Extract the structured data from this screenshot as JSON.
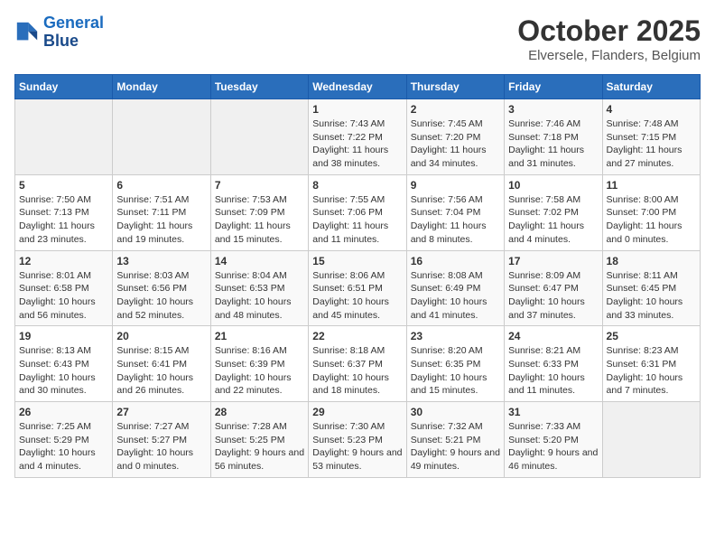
{
  "header": {
    "logo_line1": "General",
    "logo_line2": "Blue",
    "main_title": "October 2025",
    "subtitle": "Elversele, Flanders, Belgium"
  },
  "days_of_week": [
    "Sunday",
    "Monday",
    "Tuesday",
    "Wednesday",
    "Thursday",
    "Friday",
    "Saturday"
  ],
  "weeks": [
    [
      {
        "num": "",
        "sunrise": "",
        "sunset": "",
        "daylight": ""
      },
      {
        "num": "",
        "sunrise": "",
        "sunset": "",
        "daylight": ""
      },
      {
        "num": "",
        "sunrise": "",
        "sunset": "",
        "daylight": ""
      },
      {
        "num": "1",
        "sunrise": "Sunrise: 7:43 AM",
        "sunset": "Sunset: 7:22 PM",
        "daylight": "Daylight: 11 hours and 38 minutes."
      },
      {
        "num": "2",
        "sunrise": "Sunrise: 7:45 AM",
        "sunset": "Sunset: 7:20 PM",
        "daylight": "Daylight: 11 hours and 34 minutes."
      },
      {
        "num": "3",
        "sunrise": "Sunrise: 7:46 AM",
        "sunset": "Sunset: 7:18 PM",
        "daylight": "Daylight: 11 hours and 31 minutes."
      },
      {
        "num": "4",
        "sunrise": "Sunrise: 7:48 AM",
        "sunset": "Sunset: 7:15 PM",
        "daylight": "Daylight: 11 hours and 27 minutes."
      }
    ],
    [
      {
        "num": "5",
        "sunrise": "Sunrise: 7:50 AM",
        "sunset": "Sunset: 7:13 PM",
        "daylight": "Daylight: 11 hours and 23 minutes."
      },
      {
        "num": "6",
        "sunrise": "Sunrise: 7:51 AM",
        "sunset": "Sunset: 7:11 PM",
        "daylight": "Daylight: 11 hours and 19 minutes."
      },
      {
        "num": "7",
        "sunrise": "Sunrise: 7:53 AM",
        "sunset": "Sunset: 7:09 PM",
        "daylight": "Daylight: 11 hours and 15 minutes."
      },
      {
        "num": "8",
        "sunrise": "Sunrise: 7:55 AM",
        "sunset": "Sunset: 7:06 PM",
        "daylight": "Daylight: 11 hours and 11 minutes."
      },
      {
        "num": "9",
        "sunrise": "Sunrise: 7:56 AM",
        "sunset": "Sunset: 7:04 PM",
        "daylight": "Daylight: 11 hours and 8 minutes."
      },
      {
        "num": "10",
        "sunrise": "Sunrise: 7:58 AM",
        "sunset": "Sunset: 7:02 PM",
        "daylight": "Daylight: 11 hours and 4 minutes."
      },
      {
        "num": "11",
        "sunrise": "Sunrise: 8:00 AM",
        "sunset": "Sunset: 7:00 PM",
        "daylight": "Daylight: 11 hours and 0 minutes."
      }
    ],
    [
      {
        "num": "12",
        "sunrise": "Sunrise: 8:01 AM",
        "sunset": "Sunset: 6:58 PM",
        "daylight": "Daylight: 10 hours and 56 minutes."
      },
      {
        "num": "13",
        "sunrise": "Sunrise: 8:03 AM",
        "sunset": "Sunset: 6:56 PM",
        "daylight": "Daylight: 10 hours and 52 minutes."
      },
      {
        "num": "14",
        "sunrise": "Sunrise: 8:04 AM",
        "sunset": "Sunset: 6:53 PM",
        "daylight": "Daylight: 10 hours and 48 minutes."
      },
      {
        "num": "15",
        "sunrise": "Sunrise: 8:06 AM",
        "sunset": "Sunset: 6:51 PM",
        "daylight": "Daylight: 10 hours and 45 minutes."
      },
      {
        "num": "16",
        "sunrise": "Sunrise: 8:08 AM",
        "sunset": "Sunset: 6:49 PM",
        "daylight": "Daylight: 10 hours and 41 minutes."
      },
      {
        "num": "17",
        "sunrise": "Sunrise: 8:09 AM",
        "sunset": "Sunset: 6:47 PM",
        "daylight": "Daylight: 10 hours and 37 minutes."
      },
      {
        "num": "18",
        "sunrise": "Sunrise: 8:11 AM",
        "sunset": "Sunset: 6:45 PM",
        "daylight": "Daylight: 10 hours and 33 minutes."
      }
    ],
    [
      {
        "num": "19",
        "sunrise": "Sunrise: 8:13 AM",
        "sunset": "Sunset: 6:43 PM",
        "daylight": "Daylight: 10 hours and 30 minutes."
      },
      {
        "num": "20",
        "sunrise": "Sunrise: 8:15 AM",
        "sunset": "Sunset: 6:41 PM",
        "daylight": "Daylight: 10 hours and 26 minutes."
      },
      {
        "num": "21",
        "sunrise": "Sunrise: 8:16 AM",
        "sunset": "Sunset: 6:39 PM",
        "daylight": "Daylight: 10 hours and 22 minutes."
      },
      {
        "num": "22",
        "sunrise": "Sunrise: 8:18 AM",
        "sunset": "Sunset: 6:37 PM",
        "daylight": "Daylight: 10 hours and 18 minutes."
      },
      {
        "num": "23",
        "sunrise": "Sunrise: 8:20 AM",
        "sunset": "Sunset: 6:35 PM",
        "daylight": "Daylight: 10 hours and 15 minutes."
      },
      {
        "num": "24",
        "sunrise": "Sunrise: 8:21 AM",
        "sunset": "Sunset: 6:33 PM",
        "daylight": "Daylight: 10 hours and 11 minutes."
      },
      {
        "num": "25",
        "sunrise": "Sunrise: 8:23 AM",
        "sunset": "Sunset: 6:31 PM",
        "daylight": "Daylight: 10 hours and 7 minutes."
      }
    ],
    [
      {
        "num": "26",
        "sunrise": "Sunrise: 7:25 AM",
        "sunset": "Sunset: 5:29 PM",
        "daylight": "Daylight: 10 hours and 4 minutes."
      },
      {
        "num": "27",
        "sunrise": "Sunrise: 7:27 AM",
        "sunset": "Sunset: 5:27 PM",
        "daylight": "Daylight: 10 hours and 0 minutes."
      },
      {
        "num": "28",
        "sunrise": "Sunrise: 7:28 AM",
        "sunset": "Sunset: 5:25 PM",
        "daylight": "Daylight: 9 hours and 56 minutes."
      },
      {
        "num": "29",
        "sunrise": "Sunrise: 7:30 AM",
        "sunset": "Sunset: 5:23 PM",
        "daylight": "Daylight: 9 hours and 53 minutes."
      },
      {
        "num": "30",
        "sunrise": "Sunrise: 7:32 AM",
        "sunset": "Sunset: 5:21 PM",
        "daylight": "Daylight: 9 hours and 49 minutes."
      },
      {
        "num": "31",
        "sunrise": "Sunrise: 7:33 AM",
        "sunset": "Sunset: 5:20 PM",
        "daylight": "Daylight: 9 hours and 46 minutes."
      },
      {
        "num": "",
        "sunrise": "",
        "sunset": "",
        "daylight": ""
      }
    ]
  ]
}
